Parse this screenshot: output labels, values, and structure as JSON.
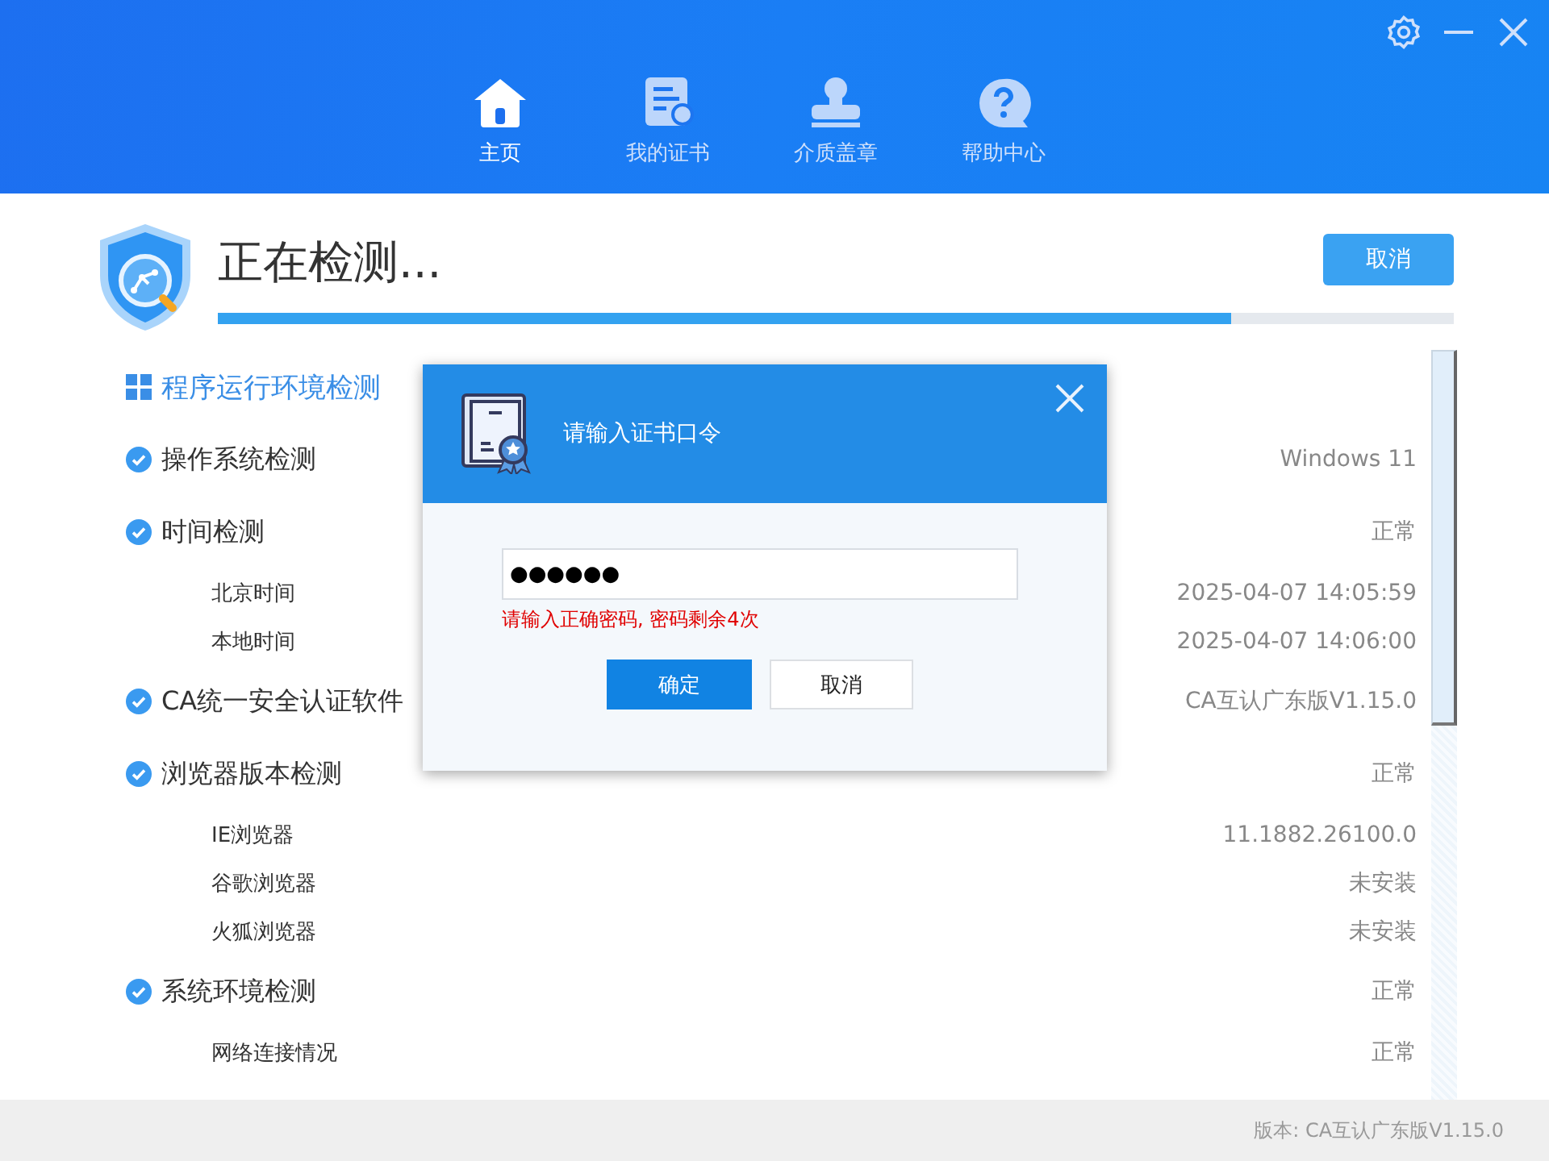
{
  "nav": [
    {
      "label": "主页",
      "kind": "home",
      "selected": true
    },
    {
      "label": "我的证书",
      "kind": "cert",
      "selected": false
    },
    {
      "label": "介质盖章",
      "kind": "stamp",
      "selected": false
    },
    {
      "label": "帮助中心",
      "kind": "help",
      "selected": false
    }
  ],
  "detection": {
    "title": "正在检测...",
    "cancel": "取消",
    "level": 0.82
  },
  "items": [
    {
      "kind": "section",
      "label": "程序运行环境检测"
    },
    {
      "kind": "check",
      "label": "操作系统检测",
      "value": "Windows 11",
      "checked": true
    },
    {
      "kind": "check",
      "label": "时间检测",
      "value": "正常",
      "checked": true
    },
    {
      "kind": "sub",
      "label": "北京时间",
      "value": "2025-04-07 14:05:59"
    },
    {
      "kind": "sub",
      "label": "本地时间",
      "value": "2025-04-07 14:06:00"
    },
    {
      "kind": "check",
      "label": "CA统一安全认证软件",
      "value": "CA互认广东版V1.15.0",
      "checked": true
    },
    {
      "kind": "check",
      "label": "浏览器版本检测",
      "value": "正常",
      "checked": true
    },
    {
      "kind": "sub",
      "label": "IE浏览器",
      "value": "11.1882.26100.0"
    },
    {
      "kind": "sub",
      "label": "谷歌浏览器",
      "value": "未安装"
    },
    {
      "kind": "sub",
      "label": "火狐浏览器",
      "value": "未安装"
    },
    {
      "kind": "check",
      "label": "系统环境检测",
      "value": "正常",
      "checked": true
    },
    {
      "kind": "sub",
      "label": "网络连接情况",
      "value": "正常"
    }
  ],
  "dialog": {
    "title": "请输入证书口令",
    "value": "●●●●●●",
    "error": "请输入正确密码, 密码剩余4次",
    "buttons": [
      {
        "label": "确定",
        "kind": "primary"
      },
      {
        "label": "取消",
        "kind": "secondary"
      }
    ]
  },
  "footer": "版本: CA互认广东版V1.15.0"
}
